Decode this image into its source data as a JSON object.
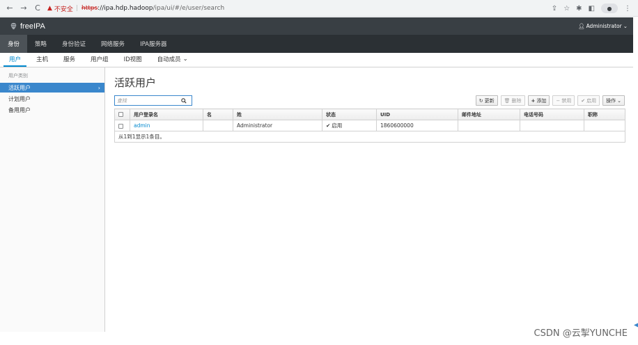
{
  "browser": {
    "back": "←",
    "forward": "→",
    "reload": "C",
    "insecure_label": "不安全",
    "url_scheme": "https",
    "url_rest": "://ipa.hdp.hadoop",
    "url_path": "/ipa/ui/#/e/user/search"
  },
  "header": {
    "brand": "freeIPA",
    "user_menu": "Administrator"
  },
  "main_nav": [
    {
      "label": "身份",
      "active": true
    },
    {
      "label": "策略",
      "active": false
    },
    {
      "label": "身份验证",
      "active": false
    },
    {
      "label": "网络服务",
      "active": false
    },
    {
      "label": "IPA服务器",
      "active": false
    }
  ],
  "sub_nav": [
    {
      "label": "用户",
      "active": true
    },
    {
      "label": "主机",
      "active": false
    },
    {
      "label": "服务",
      "active": false
    },
    {
      "label": "用户组",
      "active": false
    },
    {
      "label": "ID视图",
      "active": false
    },
    {
      "label": "自动成员",
      "active": false
    }
  ],
  "sidebar": {
    "heading": "用户类别",
    "items": [
      {
        "label": "活跃用户",
        "active": true
      },
      {
        "label": "计划用户",
        "active": false
      },
      {
        "label": "备用用户",
        "active": false
      }
    ]
  },
  "page": {
    "title": "活跃用户",
    "search_placeholder": "查找"
  },
  "toolbar": {
    "refresh": "更新",
    "delete": "删除",
    "add": "添加",
    "disable": "禁用",
    "enable": "启用",
    "actions": "操作"
  },
  "table": {
    "columns": [
      "用户登录名",
      "名",
      "姓",
      "状态",
      "UID",
      "邮件地址",
      "电话号码",
      "职称"
    ],
    "rows": [
      {
        "login": "admin",
        "first": "",
        "last": "Administrator",
        "status": "启用",
        "uid": "1860600000",
        "email": "",
        "phone": "",
        "title": ""
      }
    ],
    "footer": "从1到1显示1条目。"
  },
  "watermark": "CSDN @云掣YUNCHE",
  "colors": {
    "accent": "#0088ce",
    "sidebar_active": "#3a87cc",
    "header_bg": "#393f44",
    "nav_bg": "#2b3034"
  }
}
